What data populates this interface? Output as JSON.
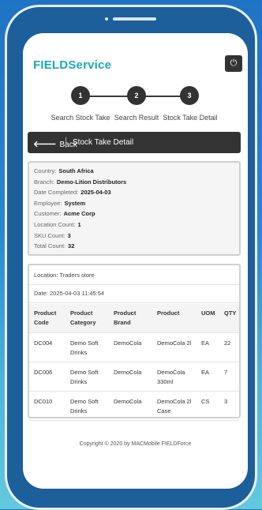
{
  "app": {
    "brand": "FIELDService"
  },
  "header": {
    "power_icon": "power-icon"
  },
  "stepper": {
    "steps": [
      {
        "number": "1",
        "label": "Search Stock Take"
      },
      {
        "number": "2",
        "label": "Search Result"
      },
      {
        "number": "3",
        "label": "Stock Take Detail"
      }
    ]
  },
  "titlebar": {
    "back_label": "Back",
    "title": "Stock Take Detail"
  },
  "summary": {
    "country": {
      "label": "Country:",
      "value": "South Africa"
    },
    "branch": {
      "label": "Branch:",
      "value": "Demo-Lition Distributors"
    },
    "date_completed": {
      "label": "Date Completed:",
      "value": "2025-04-03"
    },
    "employee": {
      "label": "Employee:",
      "value": "System"
    },
    "customer": {
      "label": "Customer:",
      "value": "Acme Corp"
    },
    "location_count": {
      "label": "Location Count:",
      "value": "1"
    },
    "sku_count": {
      "label": "SKU Count:",
      "value": "3"
    },
    "total_count": {
      "label": "Total Count:",
      "value": "32"
    }
  },
  "location_card": {
    "location": "Location: Traders store",
    "date": "Date: 2025-04-03 11:45:54",
    "columns": [
      "Product Code",
      "Product Category",
      "Product Brand",
      "Product",
      "UOM",
      "QTY"
    ],
    "rows": [
      [
        "DC004",
        "Demo Soft Drinks",
        "DemoCola",
        "DemoCola 2l",
        "EA",
        "22"
      ],
      [
        "DC006",
        "Demo Soft Drinks",
        "DemoCola",
        "DemoCola 330ml",
        "EA",
        "7"
      ],
      [
        "DC010",
        "Demo Soft Drinks",
        "DemoCola",
        "DemoCola 2l Case",
        "CS",
        "3"
      ]
    ]
  },
  "footer": {
    "copyright": "Copyright © 2020 by MACMobile FIELDForce"
  }
}
